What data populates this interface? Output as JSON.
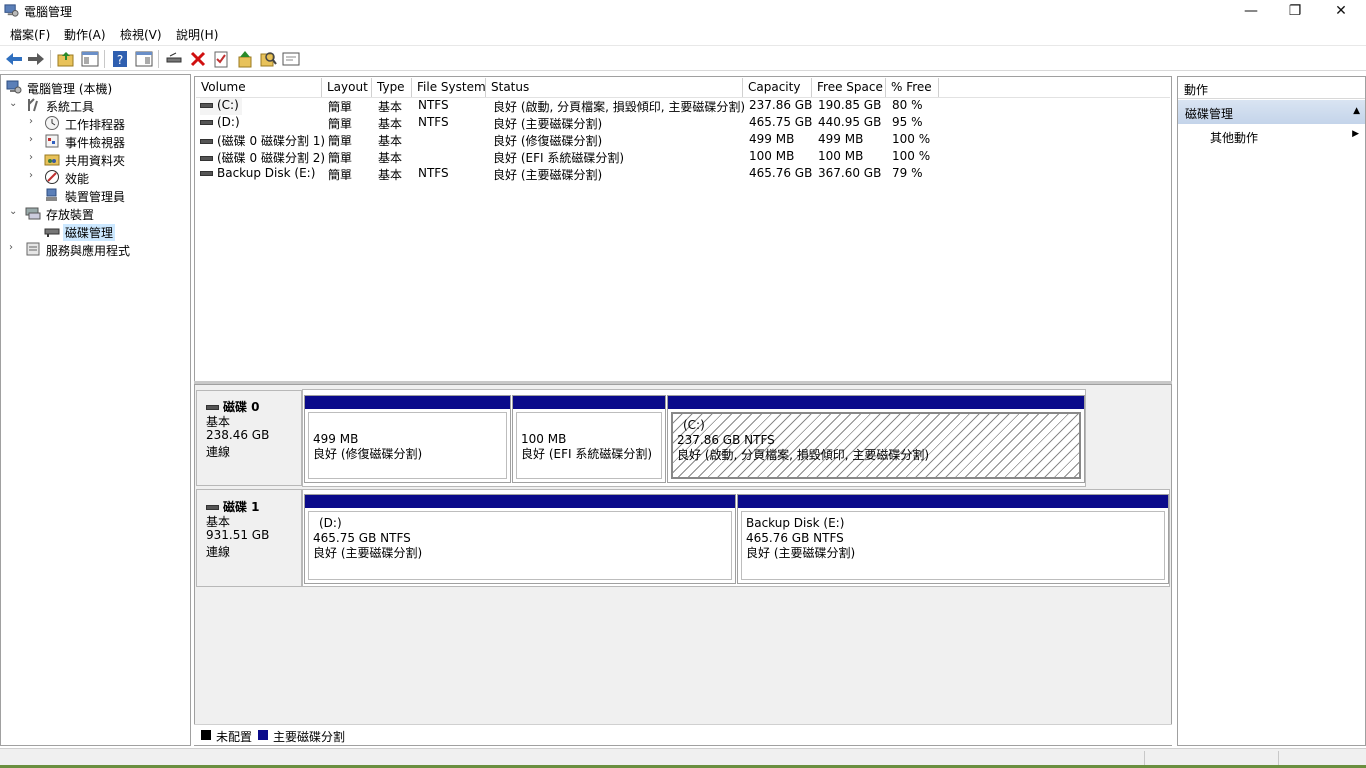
{
  "window": {
    "title": "電腦管理",
    "minimize_glyph": "—",
    "maximize_glyph": "❐",
    "close_glyph": "✕"
  },
  "menu": [
    "檔案(F)",
    "動作(A)",
    "檢視(V)",
    "說明(H)"
  ],
  "toolbar": {
    "icons": [
      "back-arrow-icon",
      "forward-arrow-icon",
      "up-folder-icon",
      "show-hide-tree-icon",
      "help-icon",
      "show-hide-action-pane-icon",
      "connect-drive-icon",
      "delete-icon",
      "properties-icon",
      "up-arrow-icon",
      "search-icon",
      "console-icon"
    ]
  },
  "tree": {
    "items": [
      {
        "label": "電腦管理 (本機)",
        "icon": "computer-management-icon"
      },
      {
        "label": "系統工具",
        "icon": "system-tools-icon"
      },
      {
        "label": "工作排程器",
        "icon": "task-scheduler-icon"
      },
      {
        "label": "事件檢視器",
        "icon": "event-viewer-icon"
      },
      {
        "label": "共用資料夾",
        "icon": "shared-folders-icon"
      },
      {
        "label": "效能",
        "icon": "performance-icon"
      },
      {
        "label": "裝置管理員",
        "icon": "device-manager-icon"
      },
      {
        "label": "存放裝置",
        "icon": "storage-icon"
      },
      {
        "label": "磁碟管理",
        "icon": "disk-management-icon"
      },
      {
        "label": "服務與應用程式",
        "icon": "services-applications-icon"
      }
    ]
  },
  "volume_list": {
    "columns": [
      "Volume",
      "Layout",
      "Type",
      "File System",
      "Status",
      "Capacity",
      "Free Space",
      "% Free"
    ],
    "rows": [
      {
        "volume": "(C:)",
        "layout": "簡單",
        "type": "基本",
        "fs": "NTFS",
        "status": "良好 (啟動, 分頁檔案, 損毀傾印, 主要磁碟分割)",
        "capacity": "237.86 GB",
        "free": "190.85 GB",
        "pct": "80 %"
      },
      {
        "volume": "(D:)",
        "layout": "簡單",
        "type": "基本",
        "fs": "NTFS",
        "status": "良好 (主要磁碟分割)",
        "capacity": "465.75 GB",
        "free": "440.95 GB",
        "pct": "95 %"
      },
      {
        "volume": "(磁碟 0 磁碟分割 1)",
        "layout": "簡單",
        "type": "基本",
        "fs": "",
        "status": "良好 (修復磁碟分割)",
        "capacity": "499 MB",
        "free": "499 MB",
        "pct": "100 %"
      },
      {
        "volume": "(磁碟 0 磁碟分割 2)",
        "layout": "簡單",
        "type": "基本",
        "fs": "",
        "status": "良好 (EFI 系統磁碟分割)",
        "capacity": "100 MB",
        "free": "100 MB",
        "pct": "100 %"
      },
      {
        "volume": "Backup Disk (E:)",
        "layout": "簡單",
        "type": "基本",
        "fs": "NTFS",
        "status": "良好 (主要磁碟分割)",
        "capacity": "465.76 GB",
        "free": "367.60 GB",
        "pct": "79 %"
      }
    ]
  },
  "disks": [
    {
      "name": "磁碟 0",
      "type": "基本",
      "size": "238.46 GB",
      "state": "連線",
      "partitions": [
        {
          "name": "",
          "line1": "499 MB",
          "line2": "良好 (修復磁碟分割)"
        },
        {
          "name": "",
          "line1": "100 MB",
          "line2": "良好 (EFI 系統磁碟分割)"
        },
        {
          "name": "(C:)",
          "line1": "237.86 GB NTFS",
          "line2": "良好 (啟動, 分頁檔案, 損毀傾印, 主要磁碟分割)"
        }
      ]
    },
    {
      "name": "磁碟 1",
      "type": "基本",
      "size": "931.51 GB",
      "state": "連線",
      "partitions": [
        {
          "name": "(D:)",
          "line1": "465.75 GB NTFS",
          "line2": "良好 (主要磁碟分割)"
        },
        {
          "name": "Backup Disk  (E:)",
          "line1": "465.76 GB NTFS",
          "line2": "良好 (主要磁碟分割)"
        }
      ]
    }
  ],
  "legend": [
    {
      "label": "未配置",
      "color": "#000000"
    },
    {
      "label": "主要磁碟分割",
      "color": "#0a0a8a"
    }
  ],
  "actions": {
    "header": "動作",
    "section": "磁碟管理",
    "item": "其他動作"
  },
  "colors": {
    "partition_bar": "#0a0a8a",
    "selection": "#cce8ff"
  }
}
